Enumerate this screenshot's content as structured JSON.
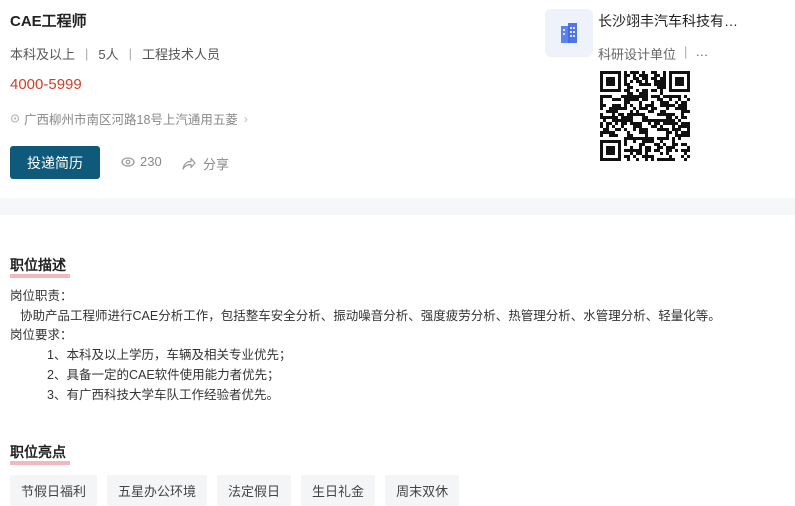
{
  "job": {
    "title": "CAE工程师",
    "education": "本科及以上",
    "headcount": "5人",
    "category": "工程技术人员",
    "salary": "4000-5999",
    "address": "广西柳州市南区河路18号上汽通用五菱",
    "apply_label": "投递简历",
    "views": "230",
    "share_label": "分享"
  },
  "company": {
    "name": "长沙翊丰汽车科技有…",
    "type": "科研设计单位",
    "type_more": "…"
  },
  "description": {
    "section_title": "职位描述",
    "lines": [
      "岗位职责：",
      "协助产品工程师进行CAE分析工作，包括整车安全分析、振动噪音分析、强度疲劳分析、热管理分析、水管理分析、轻量化等。",
      "岗位要求：",
      "1、本科及以上学历，车辆及相关专业优先；",
      "2、具备一定的CAE软件使用能力者优先；",
      "3、有广西科技大学车队工作经验者优先。"
    ]
  },
  "highlights": {
    "section_title": "职位亮点",
    "tags": [
      "节假日福利",
      "五星办公环境",
      "法定假日",
      "生日礼金",
      "周末双休"
    ]
  },
  "colors": {
    "primary": "#0f5a7a",
    "salary": "#d0402a",
    "underline": "#f2b8be"
  },
  "icons": [
    "location-pin-icon",
    "chevron-right-icon",
    "eye-icon",
    "share-icon",
    "building-icon",
    "qr-code"
  ]
}
